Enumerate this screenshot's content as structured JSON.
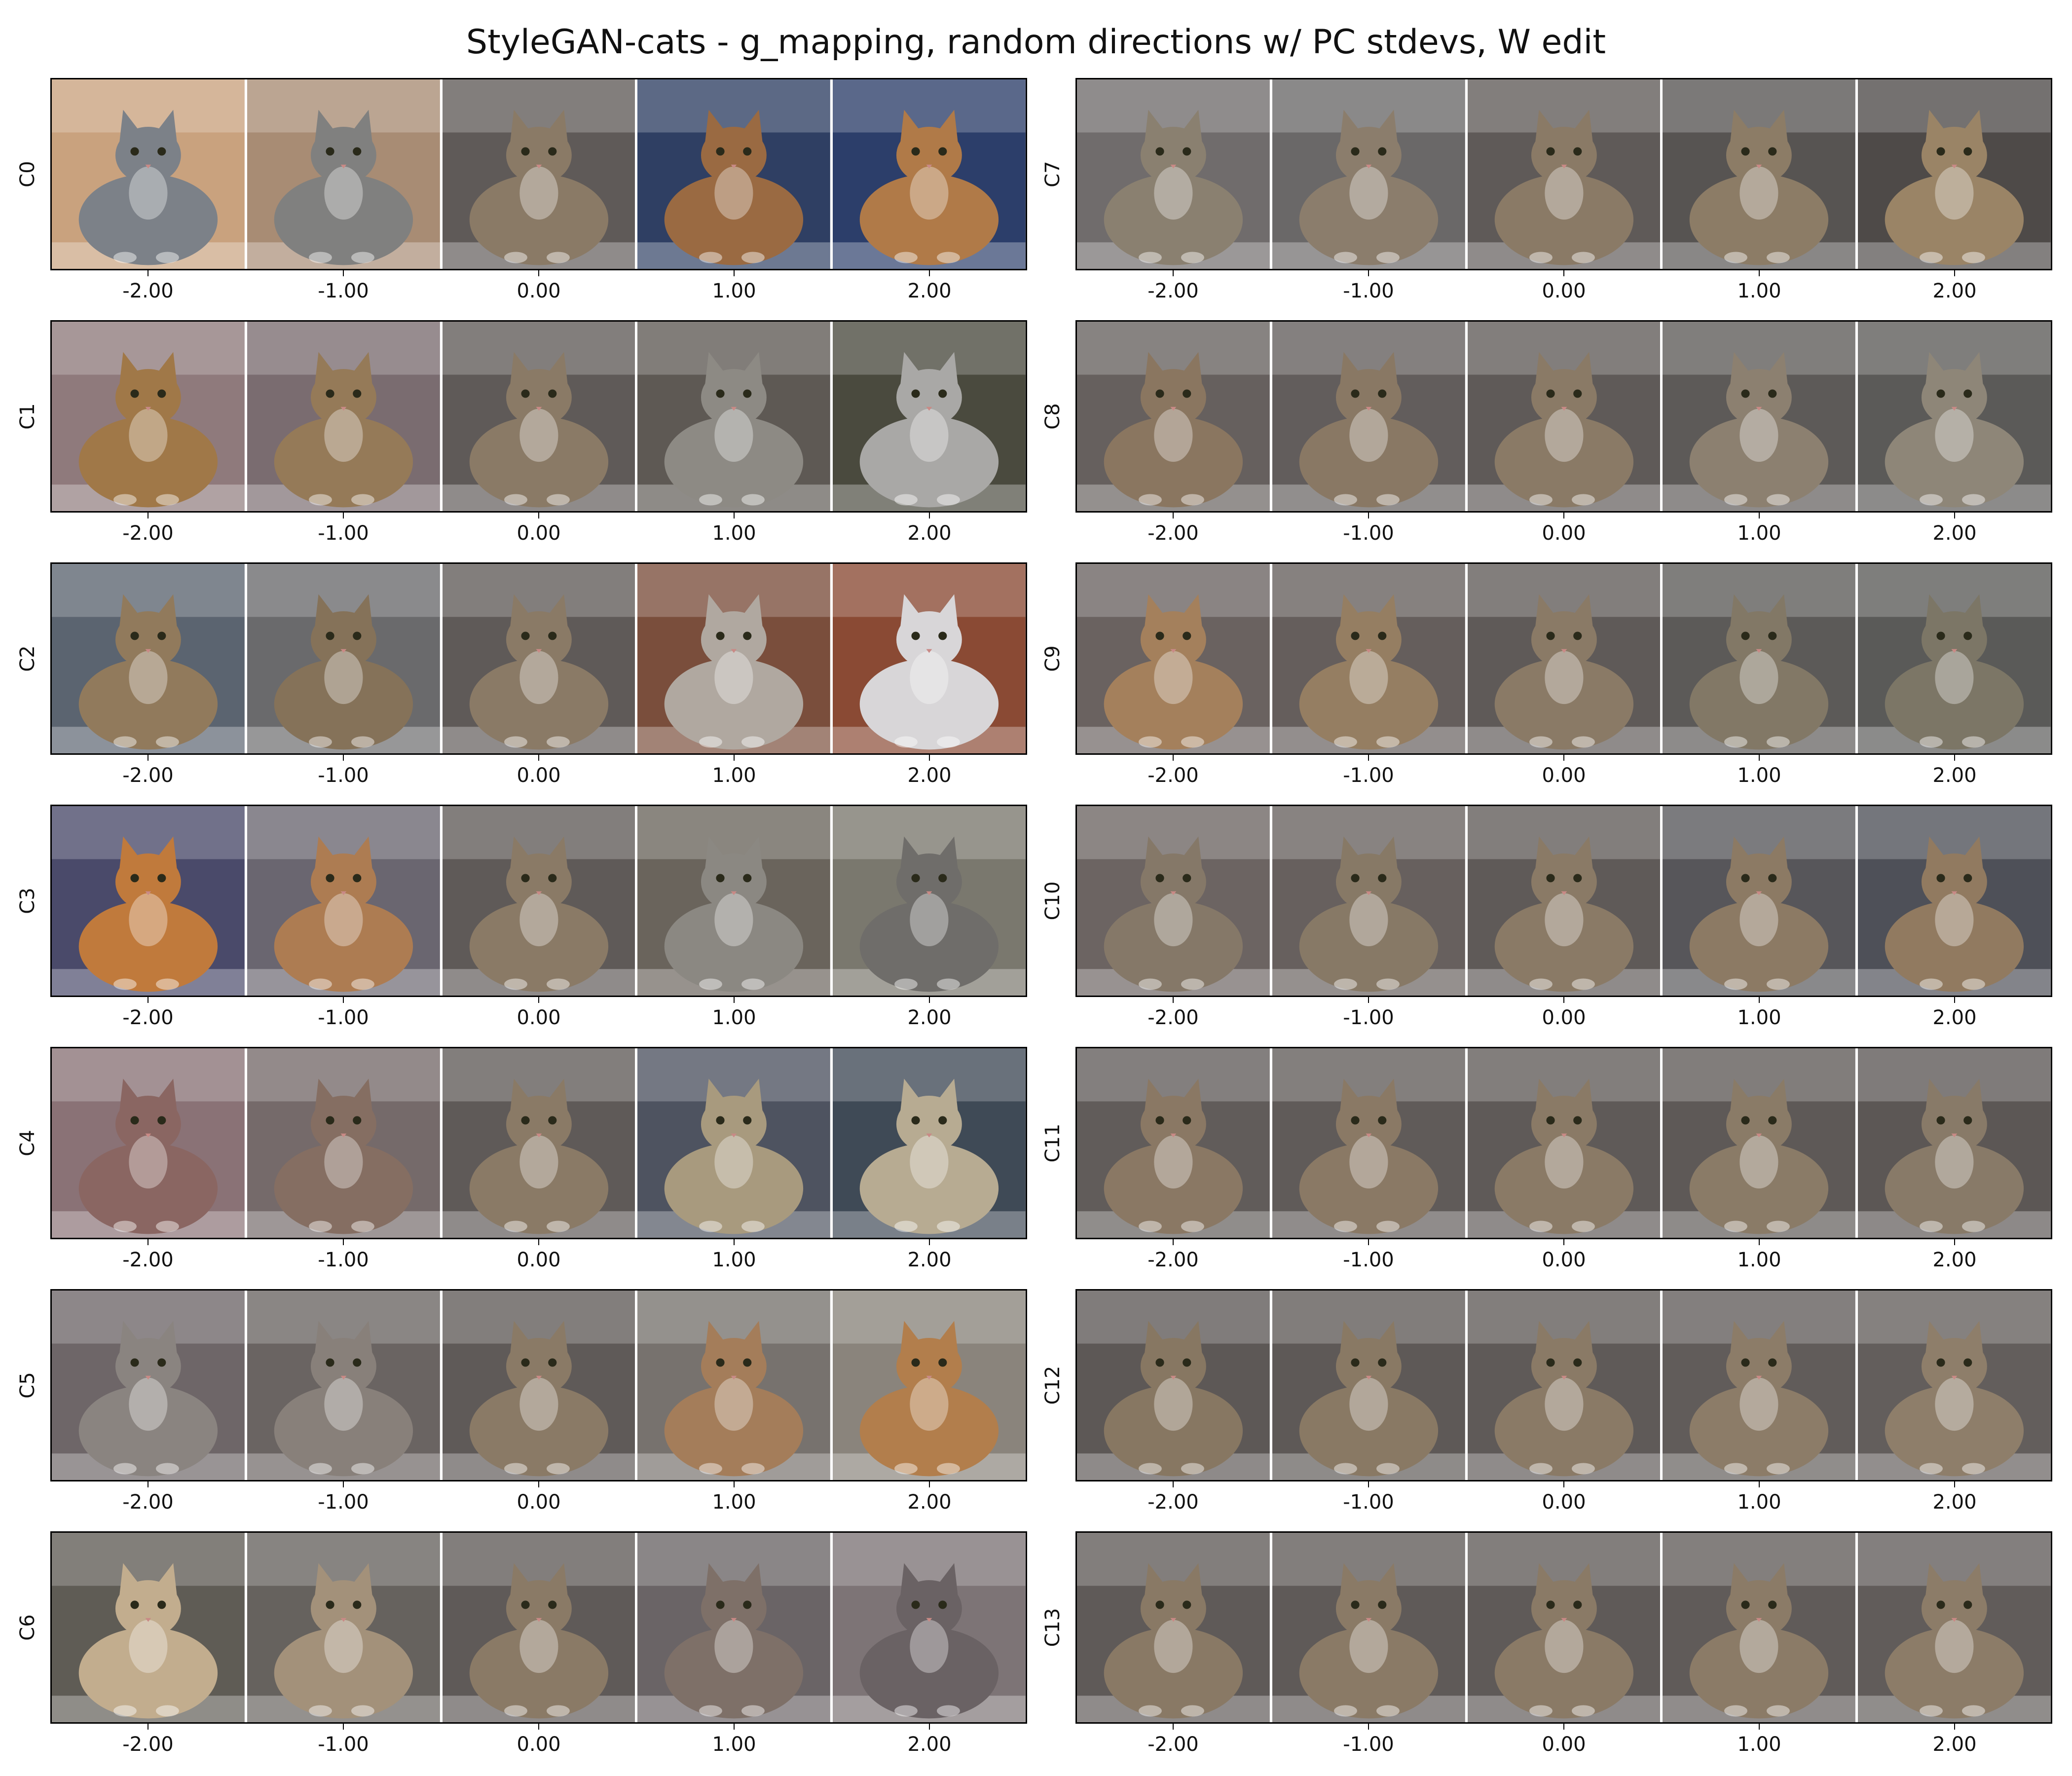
{
  "title": "StyleGAN-cats - g_mapping, random directions w/ PC stdevs, W edit",
  "columns": [
    "-2.00",
    "-1.00",
    "0.00",
    "1.00",
    "2.00"
  ],
  "components": [
    {
      "label": "C0",
      "tints": [
        [
          "#c9a27e",
          "#7c8188"
        ],
        [
          "#a88c74",
          "#80807f"
        ],
        [
          "#5f5a58",
          "#8a7a66"
        ],
        [
          "#2f3f63",
          "#9a6a42"
        ],
        [
          "#2c3e6a",
          "#b07a48"
        ]
      ]
    },
    {
      "label": "C1",
      "tints": [
        [
          "#8f7a7c",
          "#a07848"
        ],
        [
          "#7a6c70",
          "#957a58"
        ],
        [
          "#5f5a58",
          "#8a7a66"
        ],
        [
          "#5e5954",
          "#8d8a84"
        ],
        [
          "#4a4a3e",
          "#a9a8a6"
        ]
      ]
    },
    {
      "label": "C2",
      "tints": [
        [
          "#5b6470",
          "#917a5c"
        ],
        [
          "#6a6a6c",
          "#857259"
        ],
        [
          "#5f5a58",
          "#8a7a66"
        ],
        [
          "#7a4e3c",
          "#b0a8a0"
        ],
        [
          "#8a4a34",
          "#d8d6d8"
        ]
      ]
    },
    {
      "label": "C3",
      "tints": [
        [
          "#4a4a6a",
          "#c07a3c"
        ],
        [
          "#6a6670",
          "#ad7c52"
        ],
        [
          "#5f5a58",
          "#8a7a66"
        ],
        [
          "#6a645c",
          "#8b8882"
        ],
        [
          "#7a786e",
          "#6f6d6a"
        ]
      ]
    },
    {
      "label": "C4",
      "tints": [
        [
          "#8a7276",
          "#8a6662"
        ],
        [
          "#756a6a",
          "#856e62"
        ],
        [
          "#5f5a58",
          "#8a7a66"
        ],
        [
          "#4e5360",
          "#a89a7e"
        ],
        [
          "#3f4a56",
          "#b7ab92"
        ]
      ]
    },
    {
      "label": "C5",
      "tints": [
        [
          "#6e6668",
          "#8a8480"
        ],
        [
          "#6a6462",
          "#88807a"
        ],
        [
          "#5f5a58",
          "#8a7a66"
        ],
        [
          "#77726e",
          "#a47d5a"
        ],
        [
          "#8a847c",
          "#b27e4c"
        ]
      ]
    },
    {
      "label": "C6",
      "tints": [
        [
          "#5f5c55",
          "#c2ad8e"
        ],
        [
          "#66625e",
          "#a3917a"
        ],
        [
          "#5f5a58",
          "#8a7a66"
        ],
        [
          "#6a6466",
          "#7e7068"
        ],
        [
          "#7d7476",
          "#6a6264"
        ]
      ]
    },
    {
      "label": "C7",
      "tints": [
        [
          "#706c6c",
          "#8a8070"
        ],
        [
          "#6a6868",
          "#8b7d6c"
        ],
        [
          "#5f5a58",
          "#8a7a66"
        ],
        [
          "#575452",
          "#8c7c66"
        ],
        [
          "#4e4a48",
          "#9a8466"
        ]
      ]
    },
    {
      "label": "C8",
      "tints": [
        [
          "#66605e",
          "#8a7660"
        ],
        [
          "#625d5c",
          "#897864"
        ],
        [
          "#5f5a58",
          "#8a7a66"
        ],
        [
          "#5d5a58",
          "#8c8070"
        ],
        [
          "#5b5a58",
          "#8e8678"
        ]
      ]
    },
    {
      "label": "C9",
      "tints": [
        [
          "#6a6260",
          "#a4805c"
        ],
        [
          "#655e5c",
          "#957e62"
        ],
        [
          "#5f5a58",
          "#8a7a66"
        ],
        [
          "#5c5a58",
          "#827866"
        ],
        [
          "#5a5a58",
          "#7c7666"
        ]
      ]
    },
    {
      "label": "C10",
      "tints": [
        [
          "#6c6462",
          "#857868"
        ],
        [
          "#67605e",
          "#877966"
        ],
        [
          "#5f5a58",
          "#8a7a66"
        ],
        [
          "#57565a",
          "#8c7a64"
        ],
        [
          "#4e5058",
          "#917a60"
        ]
      ]
    },
    {
      "label": "C11",
      "tints": [
        [
          "#615c5a",
          "#8a7864"
        ],
        [
          "#605b59",
          "#8a7965"
        ],
        [
          "#5f5a58",
          "#8a7a66"
        ],
        [
          "#5e5957",
          "#8a7b67"
        ],
        [
          "#5c5755",
          "#887a68"
        ]
      ]
    },
    {
      "label": "C12",
      "tints": [
        [
          "#5d5856",
          "#877762"
        ],
        [
          "#5e5957",
          "#897964"
        ],
        [
          "#5f5a58",
          "#8a7a66"
        ],
        [
          "#615c5a",
          "#8c7c68"
        ],
        [
          "#635e5c",
          "#8e7e6a"
        ]
      ]
    },
    {
      "label": "C13",
      "tints": [
        [
          "#5f5a58",
          "#897965"
        ],
        [
          "#5f5a58",
          "#8a7a66"
        ],
        [
          "#5f5a58",
          "#8a7a66"
        ],
        [
          "#605b59",
          "#8b7b67"
        ],
        [
          "#615c5a",
          "#8c7c68"
        ]
      ]
    }
  ]
}
